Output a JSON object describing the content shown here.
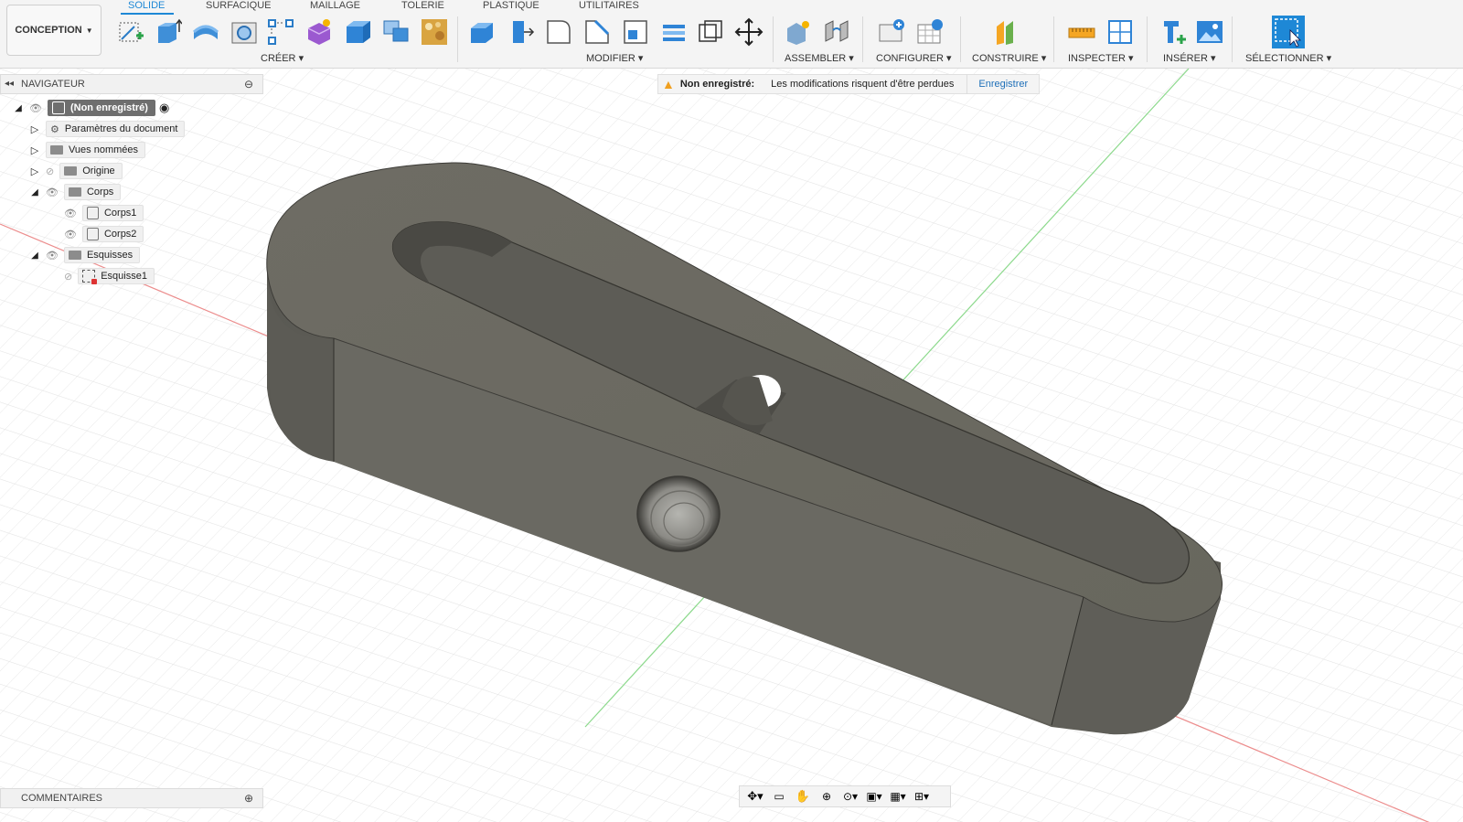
{
  "workspace": {
    "label": "CONCEPTION"
  },
  "tabs": [
    {
      "label": "SOLIDE",
      "active": true
    },
    {
      "label": "SURFACIQUE"
    },
    {
      "label": "MAILLAGE"
    },
    {
      "label": "TOLERIE"
    },
    {
      "label": "PLASTIQUE"
    },
    {
      "label": "UTILITAIRES"
    }
  ],
  "groups": {
    "creer": "CRÉER",
    "modifier": "MODIFIER",
    "assembler": "ASSEMBLER",
    "configurer": "CONFIGURER",
    "construire": "CONSTRUIRE",
    "inspecter": "INSPECTER",
    "inserer": "INSÉRER",
    "selectionner": "SÉLECTIONNER"
  },
  "colors": {
    "accent": "#1e88d6",
    "model_top": "#6b6860",
    "model_side": "#5f5e57",
    "grid": "#dcdcdc",
    "axis_red": "#e88080",
    "axis_green": "#86d786",
    "warning": "#f0a020"
  },
  "navigator": {
    "title": "NAVIGATEUR",
    "items": [
      {
        "label": "(Non enregistré)",
        "icon": "document-icon"
      },
      {
        "label": "Paramètres du document",
        "icon": "gear-icon"
      },
      {
        "label": "Vues nommées",
        "icon": "folder-icon"
      },
      {
        "label": "Origine",
        "icon": "folder-icon"
      },
      {
        "label": "Corps",
        "icon": "folder-icon"
      },
      {
        "label": "Corps1",
        "icon": "body-icon"
      },
      {
        "label": "Corps2",
        "icon": "body-icon"
      },
      {
        "label": "Esquisses",
        "icon": "folder-icon"
      },
      {
        "label": "Esquisse1",
        "icon": "sketch-icon"
      }
    ]
  },
  "warning": {
    "label": "Non enregistré:",
    "message": "Les modifications risquent d'être perdues",
    "action": "Enregistrer"
  },
  "comments": {
    "title": "COMMENTAIRES"
  }
}
